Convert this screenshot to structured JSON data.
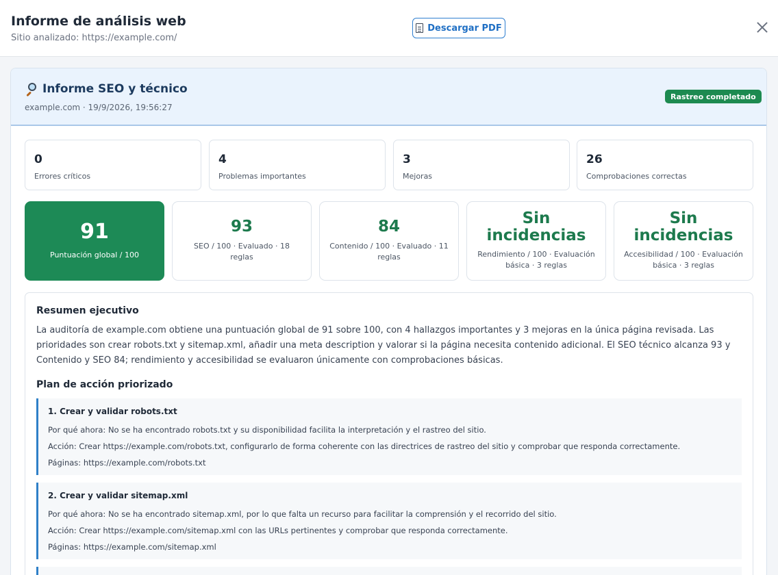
{
  "header": {
    "title": "Informe de análisis web",
    "subtitle": "Sitio analizado: https://example.com/",
    "pdf_label": "Descargar PDF"
  },
  "report": {
    "title": "Informe SEO y técnico",
    "meta": "example.com · 19/9/2026, 19:56:27",
    "status": "Rastreo completado"
  },
  "counts": [
    {
      "value": "0",
      "label": "Errores críticos"
    },
    {
      "value": "4",
      "label": "Problemas importantes"
    },
    {
      "value": "3",
      "label": "Mejoras"
    },
    {
      "value": "26",
      "label": "Comprobaciones correctas"
    }
  ],
  "scores": [
    {
      "value": "91",
      "label": "Puntuación global / 100"
    },
    {
      "value": "93",
      "label": "SEO / 100 · Evaluado · 18 reglas"
    },
    {
      "value": "84",
      "label": "Contenido / 100 · Evaluado · 11 reglas"
    },
    {
      "value": "Sin incidencias",
      "label": "Rendimiento / 100 · Evaluación básica · 3 reglas"
    },
    {
      "value": "Sin incidencias",
      "label": "Accesibilidad / 100 · Evaluación básica · 3 reglas"
    }
  ],
  "summary": {
    "heading": "Resumen ejecutivo",
    "text": "La auditoría de example.com obtiene una puntuación global de 91 sobre 100, con 4 hallazgos importantes y 3 mejoras en la única página revisada. Las prioridades son crear robots.txt y sitemap.xml, añadir una meta description y valorar si la página necesita contenido adicional. El SEO técnico alcanza 93 y Contenido y SEO 84; rendimiento y accesibilidad se evaluaron únicamente con comprobaciones básicas.",
    "plan_heading": "Plan de acción priorizado"
  },
  "actions": [
    {
      "title": "1. Crear y validar robots.txt",
      "why": "Por qué ahora: No se ha encontrado robots.txt y su disponibilidad facilita la interpretación y el rastreo del sitio.",
      "action": "Acción: Crear https://example.com/robots.txt, configurarlo de forma coherente con las directrices de rastreo del sitio y comprobar que responda correctamente.",
      "pages": "Páginas: https://example.com/robots.txt"
    },
    {
      "title": "2. Crear y validar sitemap.xml",
      "why": "Por qué ahora: No se ha encontrado sitemap.xml, por lo que falta un recurso para facilitar la comprensión y el recorrido del sitio.",
      "action": "Acción: Crear https://example.com/sitemap.xml con las URLs pertinentes y comprobar que responda correctamente.",
      "pages": "Páginas: https://example.com/sitemap.xml"
    }
  ],
  "colors": {
    "accent_blue": "#2f7fd0",
    "success_green": "#1d8a56",
    "score_green": "#1d7a4d"
  }
}
